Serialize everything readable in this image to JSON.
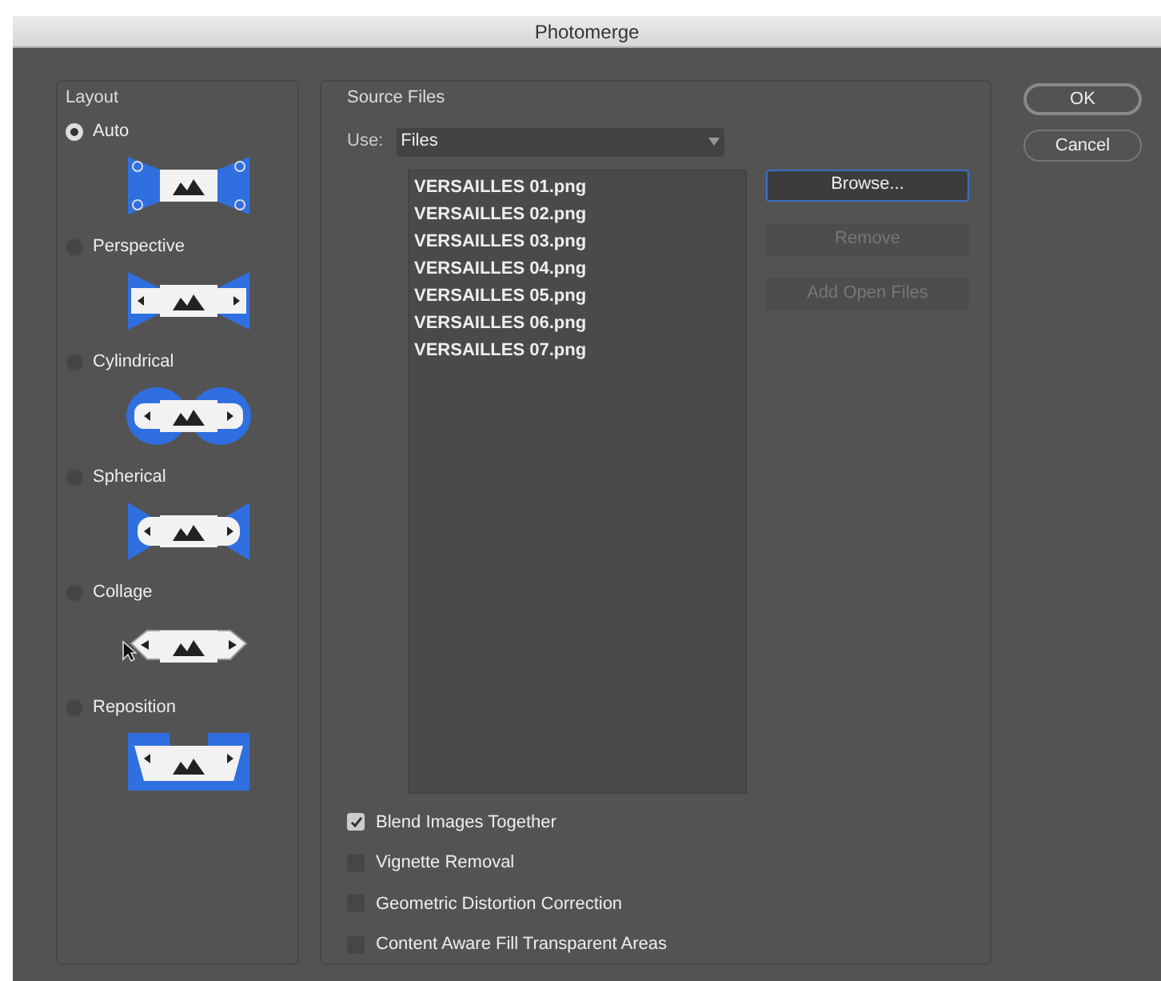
{
  "window": {
    "title": "Photomerge"
  },
  "layout": {
    "title": "Layout",
    "options": [
      {
        "label": "Auto",
        "kind": "auto",
        "selected": true
      },
      {
        "label": "Perspective",
        "kind": "perspective",
        "selected": false
      },
      {
        "label": "Cylindrical",
        "kind": "cylindrical",
        "selected": false
      },
      {
        "label": "Spherical",
        "kind": "spherical",
        "selected": false
      },
      {
        "label": "Collage",
        "kind": "collage",
        "selected": false
      },
      {
        "label": "Reposition",
        "kind": "reposition",
        "selected": false
      }
    ]
  },
  "source_files": {
    "title": "Source Files",
    "use_label": "Use:",
    "use_value": "Files",
    "files": [
      "VERSAILLES 01.png",
      "VERSAILLES 02.png",
      "VERSAILLES 03.png",
      "VERSAILLES 04.png",
      "VERSAILLES 05.png",
      "VERSAILLES 06.png",
      "VERSAILLES 07.png"
    ],
    "buttons": [
      {
        "label": "Browse...",
        "disabled": false,
        "focused": true
      },
      {
        "label": "Remove",
        "disabled": true,
        "focused": false
      },
      {
        "label": "Add Open Files",
        "disabled": true,
        "focused": false
      }
    ],
    "options": [
      {
        "label": "Blend Images Together",
        "checked": true
      },
      {
        "label": "Vignette Removal",
        "checked": false
      },
      {
        "label": "Geometric Distortion Correction",
        "checked": false
      },
      {
        "label": "Content Aware Fill Transparent Areas",
        "checked": false
      }
    ]
  },
  "actions": [
    {
      "label": "OK",
      "default": true
    },
    {
      "label": "Cancel",
      "default": false
    }
  ]
}
